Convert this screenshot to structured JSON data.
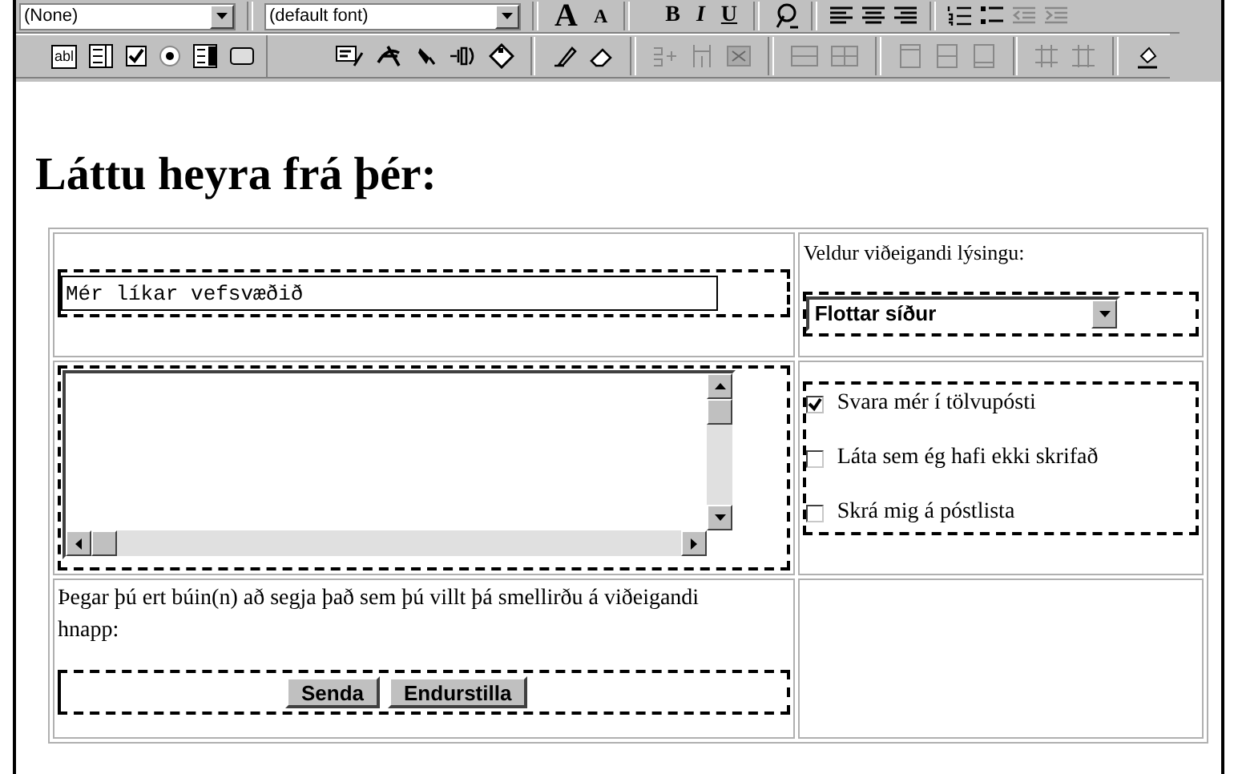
{
  "format_toolbar": {
    "style_dropdown": "(None)",
    "font_dropdown": "(default font)",
    "buttons": [
      {
        "kind": "grow",
        "label": "A"
      },
      {
        "kind": "shrink",
        "label": "A"
      },
      {
        "kind": "bold",
        "label": "B"
      },
      {
        "kind": "italic",
        "label": "I"
      },
      {
        "kind": "underline",
        "label": "U"
      }
    ]
  },
  "forms_toolbar": {
    "textbox_label": "abl"
  },
  "heading": "Láttu heyra frá þér:",
  "form": {
    "text_field": {
      "value": "Mér líkar vefsvæðið"
    },
    "description_label": "Veldur viðeigandi lýsingu:",
    "description_select": {
      "value": "Flottar síður"
    },
    "options": [
      {
        "label": "Svara mér í tölvupósti",
        "checked": true
      },
      {
        "label": "Láta sem ég hafi ekki skrifað",
        "checked": false
      },
      {
        "label": "Skrá mig á póstlista",
        "checked": false
      }
    ],
    "instruction": "Þegar þú ert búin(n) að segja það sem þú villt þá smellirðu á viðeigandi hnapp:",
    "buttons": [
      "Senda",
      "Endurstilla"
    ]
  }
}
